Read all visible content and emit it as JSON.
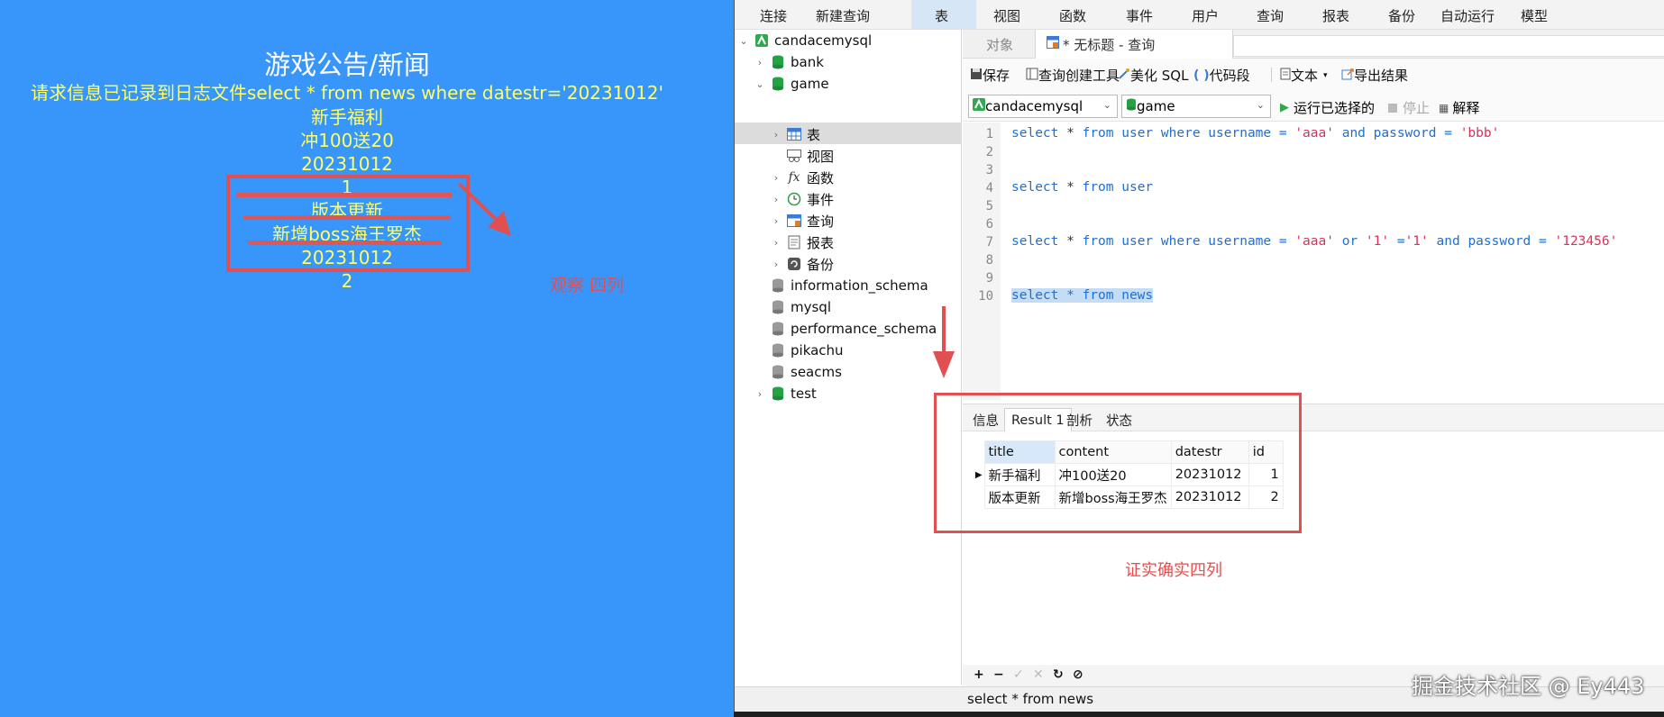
{
  "game_page": {
    "title": "游戏公告/新闻",
    "log_message": "请求信息已记录到日志文件select * from news where datestr='20231012'",
    "lines": [
      "新手福利",
      "冲100送20",
      "20231012",
      "1",
      "版本更新",
      "新增boss海王罗杰",
      "20231012",
      "2"
    ],
    "annotation": "观察 四列"
  },
  "menu": {
    "items": [
      "连接",
      "新建查询",
      "表",
      "视图",
      "函数",
      "事件",
      "用户",
      "查询",
      "报表",
      "备份",
      "自动运行",
      "模型"
    ],
    "active": "表"
  },
  "tree": {
    "connection": "candacemysql",
    "databases": [
      "bank",
      "game",
      "information_schema",
      "mysql",
      "performance_schema",
      "pikachu",
      "seacms",
      "test"
    ],
    "game_children": [
      "表",
      "视图",
      "函数",
      "事件",
      "查询",
      "报表",
      "备份"
    ]
  },
  "tabs": {
    "objects": "对象",
    "query": "* 无标题 - 查询"
  },
  "toolbar": {
    "save": "保存",
    "query_builder": "查询创建工具",
    "beautify": "美化 SQL",
    "code_snippet": "代码段",
    "text": "文本",
    "export": "导出结果"
  },
  "conn_row": {
    "connection": "candacemysql",
    "database": "game",
    "run_selected": "运行已选择的",
    "stop": "停止",
    "explain": "解释"
  },
  "editor": {
    "line_numbers": [
      "1",
      "2",
      "3",
      "4",
      "5",
      "6",
      "7",
      "8",
      "9",
      "10"
    ],
    "line1": {
      "a": "select",
      "b": " * ",
      "c": "from",
      "d": " user ",
      "e": "where",
      "f": " username = ",
      "g": "'aaa'",
      "h": " and ",
      "i": "password",
      "j": " = ",
      "k": "'bbb'"
    },
    "line4": {
      "a": "select",
      "b": " * ",
      "c": "from",
      "d": " user"
    },
    "line7": {
      "a": "select",
      "b": " * ",
      "c": "from",
      "d": " user ",
      "e": "where",
      "f": " username = ",
      "g": "'aaa'",
      "h": " or ",
      "i": "'1'",
      "j": " =",
      "k": "'1'",
      "l": " and ",
      "m": "password",
      "n": " = ",
      "o": "'123456'"
    },
    "line10": "select * from news"
  },
  "result": {
    "tabs": [
      "信息",
      "Result 1",
      "剖析",
      "状态"
    ],
    "columns": [
      "title",
      "content",
      "datestr",
      "id"
    ],
    "rows": [
      [
        "新手福利",
        "冲100送20",
        "20231012",
        "1"
      ],
      [
        "版本更新",
        "新增boss海王罗杰",
        "20231012",
        "2"
      ]
    ],
    "annotation": "证实确实四列"
  },
  "grid_toolbar": [
    "+",
    "−",
    "✓",
    "✕",
    "↻",
    "⊘"
  ],
  "status": {
    "sql": "select * from news"
  },
  "watermark": "掘金技术社区 @ Ey443",
  "colors": {
    "page_bg": "#3895fa",
    "highlight_text": "#ffff66",
    "annotation_red": "#e05050"
  }
}
